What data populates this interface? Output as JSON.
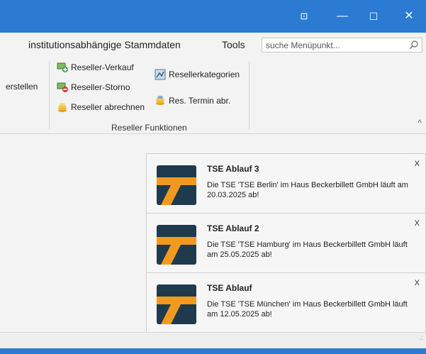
{
  "window": {
    "buttons": {
      "pin": "⊡",
      "minimize": "—",
      "maximize": "☐",
      "close": "✕"
    }
  },
  "menu": {
    "items": [
      "institutionsabhängige Stammdaten",
      "Tools"
    ],
    "search_placeholder": "suche Menüpunkt..."
  },
  "ribbon": {
    "partial_left_label": "erstellen",
    "reseller": {
      "verkauf": "Reseller-Verkauf",
      "storno": "Reseller-Storno",
      "abrechnen": "Reseller abrechnen",
      "kategorien": "Resellerkategorien",
      "termin": "Res. Termin abr."
    },
    "group_label": "Reseller Funktionen",
    "collapse": "^"
  },
  "notifications": [
    {
      "title": "TSE Ablauf 3",
      "message": "Die TSE 'TSE Berlin' im Haus Beckerbillett GmbH läuft am 20.03.2025 ab!",
      "close": "X"
    },
    {
      "title": "TSE Ablauf 2",
      "message": "Die TSE 'TSE Hamburg' im Haus Beckerbillett GmbH läuft am 25.05.2025 ab!",
      "close": "X"
    },
    {
      "title": "TSE Ablauf",
      "message": "Die TSE 'TSE München' im Haus Beckerbillett GmbH läuft am 12.05.2025 ab!",
      "close": "X"
    }
  ],
  "colors": {
    "titlebar": "#2b7bd3",
    "logo_dark": "#1f3a4d",
    "logo_orange": "#f29a1f"
  }
}
